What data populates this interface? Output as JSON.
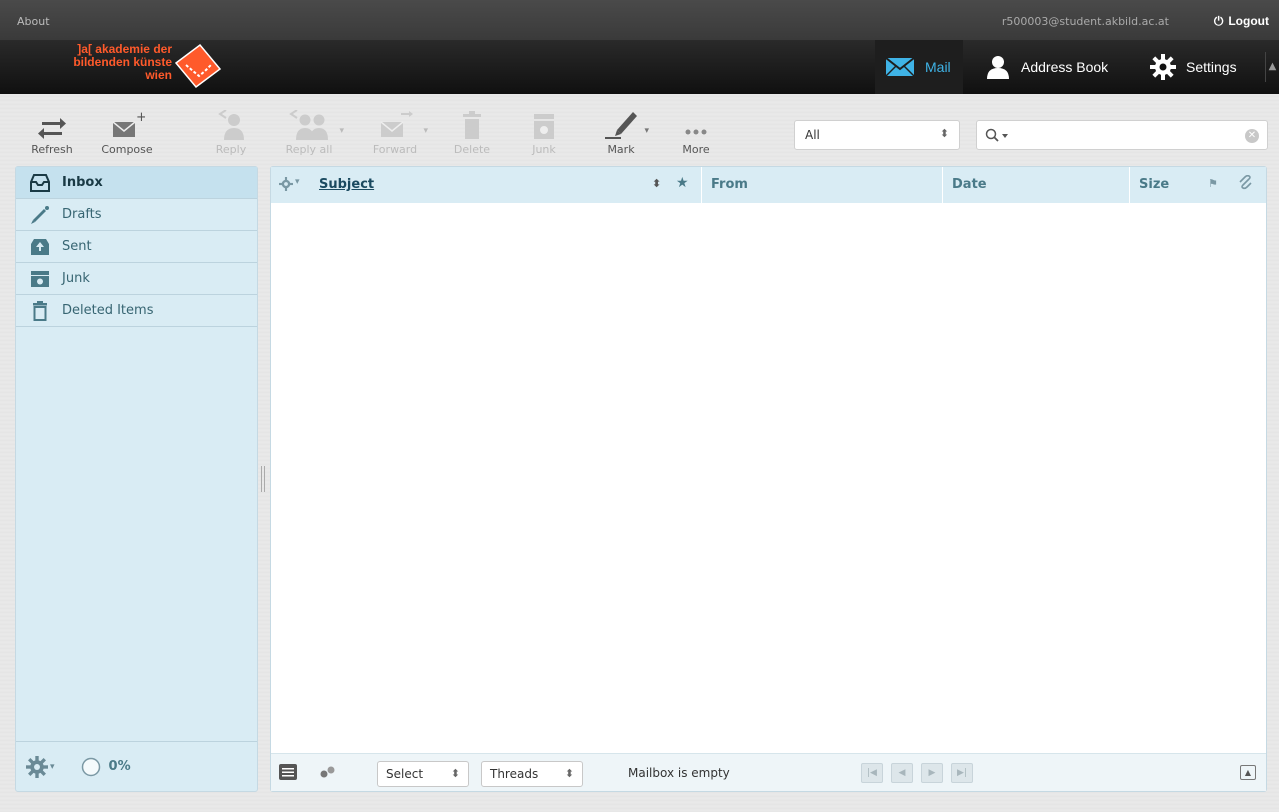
{
  "topline": {
    "about": "About",
    "username": "r500003@student.akbild.ac.at",
    "logout": "Logout"
  },
  "logo": {
    "line1": "]a[ akademie der",
    "line2": "bildenden künste",
    "line3": "wien"
  },
  "taskbar": {
    "mail": "Mail",
    "addressbook": "Address Book",
    "settings": "Settings"
  },
  "toolbar": {
    "refresh": "Refresh",
    "compose": "Compose",
    "reply": "Reply",
    "replyall": "Reply all",
    "forward": "Forward",
    "delete": "Delete",
    "junk": "Junk",
    "mark": "Mark",
    "more": "More"
  },
  "filter": {
    "value": "All"
  },
  "folders": [
    {
      "label": "Inbox",
      "icon": "inbox-icon",
      "active": true
    },
    {
      "label": "Drafts",
      "icon": "pencil-icon",
      "active": false
    },
    {
      "label": "Sent",
      "icon": "sent-icon",
      "active": false
    },
    {
      "label": "Junk",
      "icon": "junk-icon",
      "active": false
    },
    {
      "label": "Deleted Items",
      "icon": "trash-icon",
      "active": false
    }
  ],
  "quota": {
    "text": "0%"
  },
  "list": {
    "columns": {
      "subject": "Subject",
      "from": "From",
      "date": "Date",
      "size": "Size"
    },
    "select": "Select",
    "threads": "Threads",
    "status": "Mailbox is empty"
  },
  "colors": {
    "accent": "#3fb3e6",
    "panel": "#d9ecf4",
    "brand": "#ff5a2b"
  }
}
